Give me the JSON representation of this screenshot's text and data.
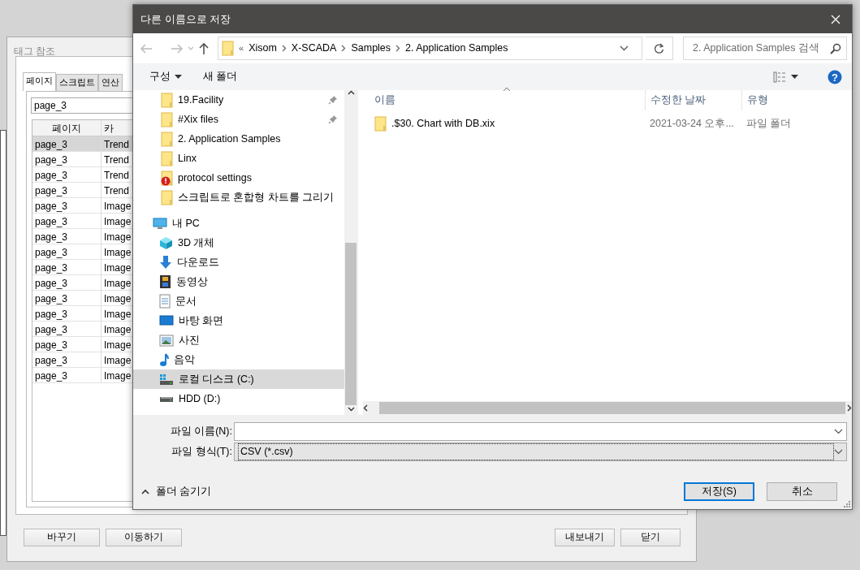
{
  "background_window": {
    "title": "태그 참조",
    "tabs": [
      {
        "label": "페이지",
        "selected": true
      },
      {
        "label": "스크립트",
        "selected": false
      },
      {
        "label": "연산",
        "selected": false
      }
    ],
    "search": {
      "value": "page_3"
    },
    "table": {
      "columns": [
        "페이지",
        "카"
      ],
      "rows": [
        {
          "cells": [
            "page_3",
            "Trend"
          ],
          "selected": true
        },
        {
          "cells": [
            "page_3",
            "Trend"
          ],
          "selected": false
        },
        {
          "cells": [
            "page_3",
            "Trend"
          ],
          "selected": false
        },
        {
          "cells": [
            "page_3",
            "Trend"
          ],
          "selected": false
        },
        {
          "cells": [
            "page_3",
            "Image"
          ],
          "selected": false
        },
        {
          "cells": [
            "page_3",
            "Image"
          ],
          "selected": false
        },
        {
          "cells": [
            "page_3",
            "Image"
          ],
          "selected": false
        },
        {
          "cells": [
            "page_3",
            "Image"
          ],
          "selected": false
        },
        {
          "cells": [
            "page_3",
            "Image"
          ],
          "selected": false
        },
        {
          "cells": [
            "page_3",
            "Image"
          ],
          "selected": false
        },
        {
          "cells": [
            "page_3",
            "Image"
          ],
          "selected": false
        },
        {
          "cells": [
            "page_3",
            "Image"
          ],
          "selected": false
        },
        {
          "cells": [
            "page_3",
            "Image"
          ],
          "selected": false
        },
        {
          "cells": [
            "page_3",
            "Image"
          ],
          "selected": false
        },
        {
          "cells": [
            "page_3",
            "Image"
          ],
          "selected": false
        },
        {
          "cells": [
            "page_3",
            "Image"
          ],
          "selected": false
        }
      ]
    },
    "buttons_left": [
      "바꾸기",
      "이동하기"
    ],
    "buttons_right": [
      "내보내기",
      "닫기"
    ]
  },
  "dialog": {
    "title": "다른 이름으로 저장",
    "address": {
      "overflow": "«",
      "crumbs": [
        "Xisom",
        "X-SCADA",
        "Samples",
        "2. Application Samples"
      ]
    },
    "search": {
      "placeholder": "2. Application Samples 검색"
    },
    "toolbar": {
      "organize": "구성",
      "new_folder": "새 폴더"
    },
    "nav": [
      {
        "label": "19.Facility",
        "kind": "folder",
        "pinned": true,
        "selected": false
      },
      {
        "label": "#Xix files",
        "kind": "folder",
        "pinned": true,
        "selected": false
      },
      {
        "label": "2. Application Samples",
        "kind": "folder",
        "pinned": false,
        "selected": false
      },
      {
        "label": "Linx",
        "kind": "folder",
        "pinned": false,
        "selected": false
      },
      {
        "label": "protocol settings",
        "kind": "folder-warning",
        "pinned": false,
        "selected": false
      },
      {
        "label": "스크립트로 혼합형 차트를 그리기",
        "kind": "folder",
        "pinned": false,
        "selected": false
      },
      {
        "label": "내 PC",
        "kind": "pc",
        "pinned": false,
        "selected": false,
        "children": [
          {
            "label": "3D 개체",
            "kind": "cube",
            "pinned": false,
            "selected": false
          },
          {
            "label": "다운로드",
            "kind": "download",
            "pinned": false,
            "selected": false
          },
          {
            "label": "동영상",
            "kind": "film",
            "pinned": false,
            "selected": false
          },
          {
            "label": "문서",
            "kind": "document",
            "pinned": false,
            "selected": false
          },
          {
            "label": "바탕 화면",
            "kind": "desktop",
            "pinned": false,
            "selected": false
          },
          {
            "label": "사진",
            "kind": "picture",
            "pinned": false,
            "selected": false
          },
          {
            "label": "음악",
            "kind": "music",
            "pinned": false,
            "selected": false
          },
          {
            "label": "로컬 디스크 (C:)",
            "kind": "system-drive",
            "pinned": false,
            "selected": true
          },
          {
            "label": "HDD (D:)",
            "kind": "drive",
            "pinned": false,
            "selected": false
          }
        ]
      }
    ],
    "columns": [
      "이름",
      "수정한 날짜",
      "유형"
    ],
    "files": [
      {
        "name": ".$30. Chart with DB.xix",
        "modified": "2021-03-24 오후...",
        "type": "파일 폴더"
      }
    ],
    "help": "?",
    "fields": [
      {
        "label": "파일 이름(N):",
        "kind": "combo-edit"
      },
      {
        "label": "파일 형식(T):",
        "value": "CSV (*.csv)",
        "kind": "combo-list"
      }
    ],
    "toggle": "폴더 숨기기",
    "buttons": [
      {
        "label": "저장(S)",
        "primary": true
      },
      {
        "label": "취소",
        "primary": false
      }
    ]
  }
}
